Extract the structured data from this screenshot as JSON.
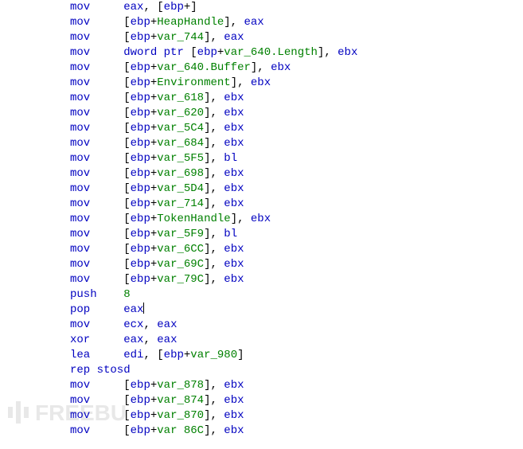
{
  "watermark": "FREEBU",
  "lines": [
    {
      "mne": "mov",
      "parts": [
        {
          "t": "reg",
          "v": "eax"
        },
        {
          "t": "pun",
          "v": ", ["
        },
        {
          "t": "reg",
          "v": "ebp"
        },
        {
          "t": "pun",
          "v": "+"
        },
        {
          "t": "var",
          "v": ""
        },
        {
          "t": "pun",
          "v": "]"
        }
      ],
      "cut": true
    },
    {
      "mne": "mov",
      "parts": [
        {
          "t": "pun",
          "v": "["
        },
        {
          "t": "reg",
          "v": "ebp"
        },
        {
          "t": "pun",
          "v": "+"
        },
        {
          "t": "var",
          "v": "HeapHandle"
        },
        {
          "t": "pun",
          "v": "], "
        },
        {
          "t": "reg",
          "v": "eax"
        }
      ]
    },
    {
      "mne": "mov",
      "parts": [
        {
          "t": "pun",
          "v": "["
        },
        {
          "t": "reg",
          "v": "ebp"
        },
        {
          "t": "pun",
          "v": "+"
        },
        {
          "t": "var",
          "v": "var_744"
        },
        {
          "t": "pun",
          "v": "], "
        },
        {
          "t": "reg",
          "v": "eax"
        }
      ]
    },
    {
      "mne": "mov",
      "parts": [
        {
          "t": "kw",
          "v": "dword ptr"
        },
        {
          "t": "pun",
          "v": " ["
        },
        {
          "t": "reg",
          "v": "ebp"
        },
        {
          "t": "pun",
          "v": "+"
        },
        {
          "t": "var",
          "v": "var_640.Length"
        },
        {
          "t": "pun",
          "v": "], "
        },
        {
          "t": "reg",
          "v": "ebx"
        }
      ]
    },
    {
      "mne": "mov",
      "parts": [
        {
          "t": "pun",
          "v": "["
        },
        {
          "t": "reg",
          "v": "ebp"
        },
        {
          "t": "pun",
          "v": "+"
        },
        {
          "t": "var",
          "v": "var_640.Buffer"
        },
        {
          "t": "pun",
          "v": "], "
        },
        {
          "t": "reg",
          "v": "ebx"
        }
      ]
    },
    {
      "mne": "mov",
      "parts": [
        {
          "t": "pun",
          "v": "["
        },
        {
          "t": "reg",
          "v": "ebp"
        },
        {
          "t": "pun",
          "v": "+"
        },
        {
          "t": "var",
          "v": "Environment"
        },
        {
          "t": "pun",
          "v": "], "
        },
        {
          "t": "reg",
          "v": "ebx"
        }
      ]
    },
    {
      "mne": "mov",
      "parts": [
        {
          "t": "pun",
          "v": "["
        },
        {
          "t": "reg",
          "v": "ebp"
        },
        {
          "t": "pun",
          "v": "+"
        },
        {
          "t": "var",
          "v": "var_618"
        },
        {
          "t": "pun",
          "v": "], "
        },
        {
          "t": "reg",
          "v": "ebx"
        }
      ]
    },
    {
      "mne": "mov",
      "parts": [
        {
          "t": "pun",
          "v": "["
        },
        {
          "t": "reg",
          "v": "ebp"
        },
        {
          "t": "pun",
          "v": "+"
        },
        {
          "t": "var",
          "v": "var_620"
        },
        {
          "t": "pun",
          "v": "], "
        },
        {
          "t": "reg",
          "v": "ebx"
        }
      ]
    },
    {
      "mne": "mov",
      "parts": [
        {
          "t": "pun",
          "v": "["
        },
        {
          "t": "reg",
          "v": "ebp"
        },
        {
          "t": "pun",
          "v": "+"
        },
        {
          "t": "var",
          "v": "var_5C4"
        },
        {
          "t": "pun",
          "v": "], "
        },
        {
          "t": "reg",
          "v": "ebx"
        }
      ]
    },
    {
      "mne": "mov",
      "parts": [
        {
          "t": "pun",
          "v": "["
        },
        {
          "t": "reg",
          "v": "ebp"
        },
        {
          "t": "pun",
          "v": "+"
        },
        {
          "t": "var",
          "v": "var_684"
        },
        {
          "t": "pun",
          "v": "], "
        },
        {
          "t": "reg",
          "v": "ebx"
        }
      ]
    },
    {
      "mne": "mov",
      "parts": [
        {
          "t": "pun",
          "v": "["
        },
        {
          "t": "reg",
          "v": "ebp"
        },
        {
          "t": "pun",
          "v": "+"
        },
        {
          "t": "var",
          "v": "var_5F5"
        },
        {
          "t": "pun",
          "v": "], "
        },
        {
          "t": "reg",
          "v": "bl"
        }
      ]
    },
    {
      "mne": "mov",
      "parts": [
        {
          "t": "pun",
          "v": "["
        },
        {
          "t": "reg",
          "v": "ebp"
        },
        {
          "t": "pun",
          "v": "+"
        },
        {
          "t": "var",
          "v": "var_698"
        },
        {
          "t": "pun",
          "v": "], "
        },
        {
          "t": "reg",
          "v": "ebx"
        }
      ]
    },
    {
      "mne": "mov",
      "parts": [
        {
          "t": "pun",
          "v": "["
        },
        {
          "t": "reg",
          "v": "ebp"
        },
        {
          "t": "pun",
          "v": "+"
        },
        {
          "t": "var",
          "v": "var_5D4"
        },
        {
          "t": "pun",
          "v": "], "
        },
        {
          "t": "reg",
          "v": "ebx"
        }
      ]
    },
    {
      "mne": "mov",
      "parts": [
        {
          "t": "pun",
          "v": "["
        },
        {
          "t": "reg",
          "v": "ebp"
        },
        {
          "t": "pun",
          "v": "+"
        },
        {
          "t": "var",
          "v": "var_714"
        },
        {
          "t": "pun",
          "v": "], "
        },
        {
          "t": "reg",
          "v": "ebx"
        }
      ]
    },
    {
      "mne": "mov",
      "parts": [
        {
          "t": "pun",
          "v": "["
        },
        {
          "t": "reg",
          "v": "ebp"
        },
        {
          "t": "pun",
          "v": "+"
        },
        {
          "t": "var",
          "v": "TokenHandle"
        },
        {
          "t": "pun",
          "v": "], "
        },
        {
          "t": "reg",
          "v": "ebx"
        }
      ]
    },
    {
      "mne": "mov",
      "parts": [
        {
          "t": "pun",
          "v": "["
        },
        {
          "t": "reg",
          "v": "ebp"
        },
        {
          "t": "pun",
          "v": "+"
        },
        {
          "t": "var",
          "v": "var_5F9"
        },
        {
          "t": "pun",
          "v": "], "
        },
        {
          "t": "reg",
          "v": "bl"
        }
      ]
    },
    {
      "mne": "mov",
      "parts": [
        {
          "t": "pun",
          "v": "["
        },
        {
          "t": "reg",
          "v": "ebp"
        },
        {
          "t": "pun",
          "v": "+"
        },
        {
          "t": "var",
          "v": "var_6CC"
        },
        {
          "t": "pun",
          "v": "], "
        },
        {
          "t": "reg",
          "v": "ebx"
        }
      ]
    },
    {
      "mne": "mov",
      "parts": [
        {
          "t": "pun",
          "v": "["
        },
        {
          "t": "reg",
          "v": "ebp"
        },
        {
          "t": "pun",
          "v": "+"
        },
        {
          "t": "var",
          "v": "var_69C"
        },
        {
          "t": "pun",
          "v": "], "
        },
        {
          "t": "reg",
          "v": "ebx"
        }
      ]
    },
    {
      "mne": "mov",
      "parts": [
        {
          "t": "pun",
          "v": "["
        },
        {
          "t": "reg",
          "v": "ebp"
        },
        {
          "t": "pun",
          "v": "+"
        },
        {
          "t": "var",
          "v": "var_79C"
        },
        {
          "t": "pun",
          "v": "], "
        },
        {
          "t": "reg",
          "v": "ebx"
        }
      ]
    },
    {
      "mne": "push",
      "parts": [
        {
          "t": "num",
          "v": "8"
        }
      ]
    },
    {
      "mne": "pop",
      "parts": [
        {
          "t": "reg",
          "v": "eax"
        }
      ],
      "cursor": true
    },
    {
      "mne": "mov",
      "parts": [
        {
          "t": "reg",
          "v": "ecx"
        },
        {
          "t": "pun",
          "v": ", "
        },
        {
          "t": "reg",
          "v": "eax"
        }
      ]
    },
    {
      "mne": "xor",
      "parts": [
        {
          "t": "reg",
          "v": "eax"
        },
        {
          "t": "pun",
          "v": ", "
        },
        {
          "t": "reg",
          "v": "eax"
        }
      ]
    },
    {
      "mne": "lea",
      "parts": [
        {
          "t": "reg",
          "v": "edi"
        },
        {
          "t": "pun",
          "v": ", ["
        },
        {
          "t": "reg",
          "v": "ebp"
        },
        {
          "t": "pun",
          "v": "+"
        },
        {
          "t": "var",
          "v": "var_980"
        },
        {
          "t": "pun",
          "v": "]"
        }
      ]
    },
    {
      "mne": "rep stosd",
      "parts": [],
      "noindent": true
    },
    {
      "mne": "mov",
      "parts": [
        {
          "t": "pun",
          "v": "["
        },
        {
          "t": "reg",
          "v": "ebp"
        },
        {
          "t": "pun",
          "v": "+"
        },
        {
          "t": "var",
          "v": "var_878"
        },
        {
          "t": "pun",
          "v": "], "
        },
        {
          "t": "reg",
          "v": "ebx"
        }
      ]
    },
    {
      "mne": "mov",
      "parts": [
        {
          "t": "pun",
          "v": "["
        },
        {
          "t": "reg",
          "v": "ebp"
        },
        {
          "t": "pun",
          "v": "+"
        },
        {
          "t": "var",
          "v": "var_874"
        },
        {
          "t": "pun",
          "v": "], "
        },
        {
          "t": "reg",
          "v": "ebx"
        }
      ]
    },
    {
      "mne": "mov",
      "parts": [
        {
          "t": "pun",
          "v": "["
        },
        {
          "t": "reg",
          "v": "ebp"
        },
        {
          "t": "pun",
          "v": "+"
        },
        {
          "t": "var",
          "v": "var_870"
        },
        {
          "t": "pun",
          "v": "], "
        },
        {
          "t": "reg",
          "v": "ebx"
        }
      ]
    },
    {
      "mne": "mov",
      "parts": [
        {
          "t": "pun",
          "v": "["
        },
        {
          "t": "reg",
          "v": "ebp"
        },
        {
          "t": "pun",
          "v": "+"
        },
        {
          "t": "var",
          "v": "var 86C"
        },
        {
          "t": "pun",
          "v": "], "
        },
        {
          "t": "reg",
          "v": "ebx"
        }
      ],
      "cut": true
    }
  ]
}
